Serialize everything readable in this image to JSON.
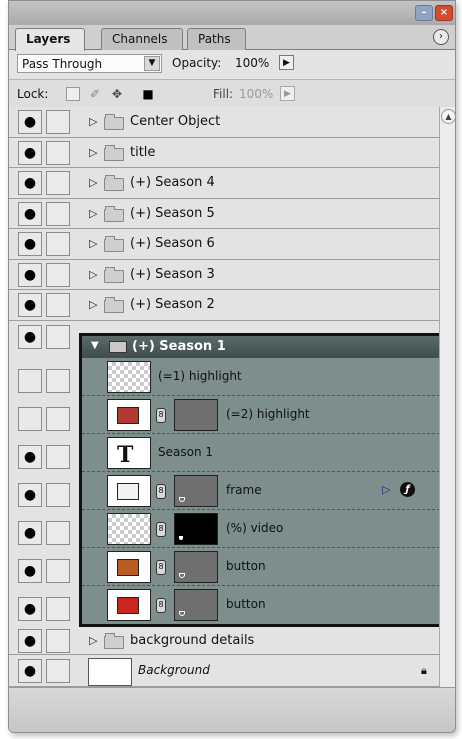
{
  "tabs": [
    {
      "label": "Layers",
      "active": true
    },
    {
      "label": "Channels",
      "active": false
    },
    {
      "label": "Paths",
      "active": false
    }
  ],
  "options": {
    "blend_mode": "Pass Through",
    "opacity_label": "Opacity:",
    "opacity_value": "100%",
    "lock_label": "Lock:",
    "fill_label": "Fill:",
    "fill_value": "100%"
  },
  "layers": [
    {
      "name": "Center Object"
    },
    {
      "name": "title"
    },
    {
      "name": "(+) Season 4"
    },
    {
      "name": "(+) Season 5"
    },
    {
      "name": "(+) Season 6"
    },
    {
      "name": "(+) Season 3"
    },
    {
      "name": "(+) Season 2"
    }
  ],
  "group": {
    "name": "(+) Season 1",
    "children": [
      {
        "name": "(=1) highlight",
        "visible": false
      },
      {
        "name": "(=2) highlight",
        "visible": false,
        "color": "#b23a35"
      },
      {
        "name": "Season 1",
        "visible": true
      },
      {
        "name": "frame",
        "visible": true,
        "color": "#f2f2f2"
      },
      {
        "name": "(%) video",
        "visible": true
      },
      {
        "name": "button",
        "visible": true,
        "color": "#b85d20"
      },
      {
        "name": "button",
        "visible": true,
        "color": "#c8261e"
      }
    ]
  },
  "after_group": {
    "name": "background details"
  },
  "background_layer": {
    "name": "Background"
  },
  "colors": {
    "group_bg": "#7e8e8c",
    "group_header": "#4b5958"
  }
}
